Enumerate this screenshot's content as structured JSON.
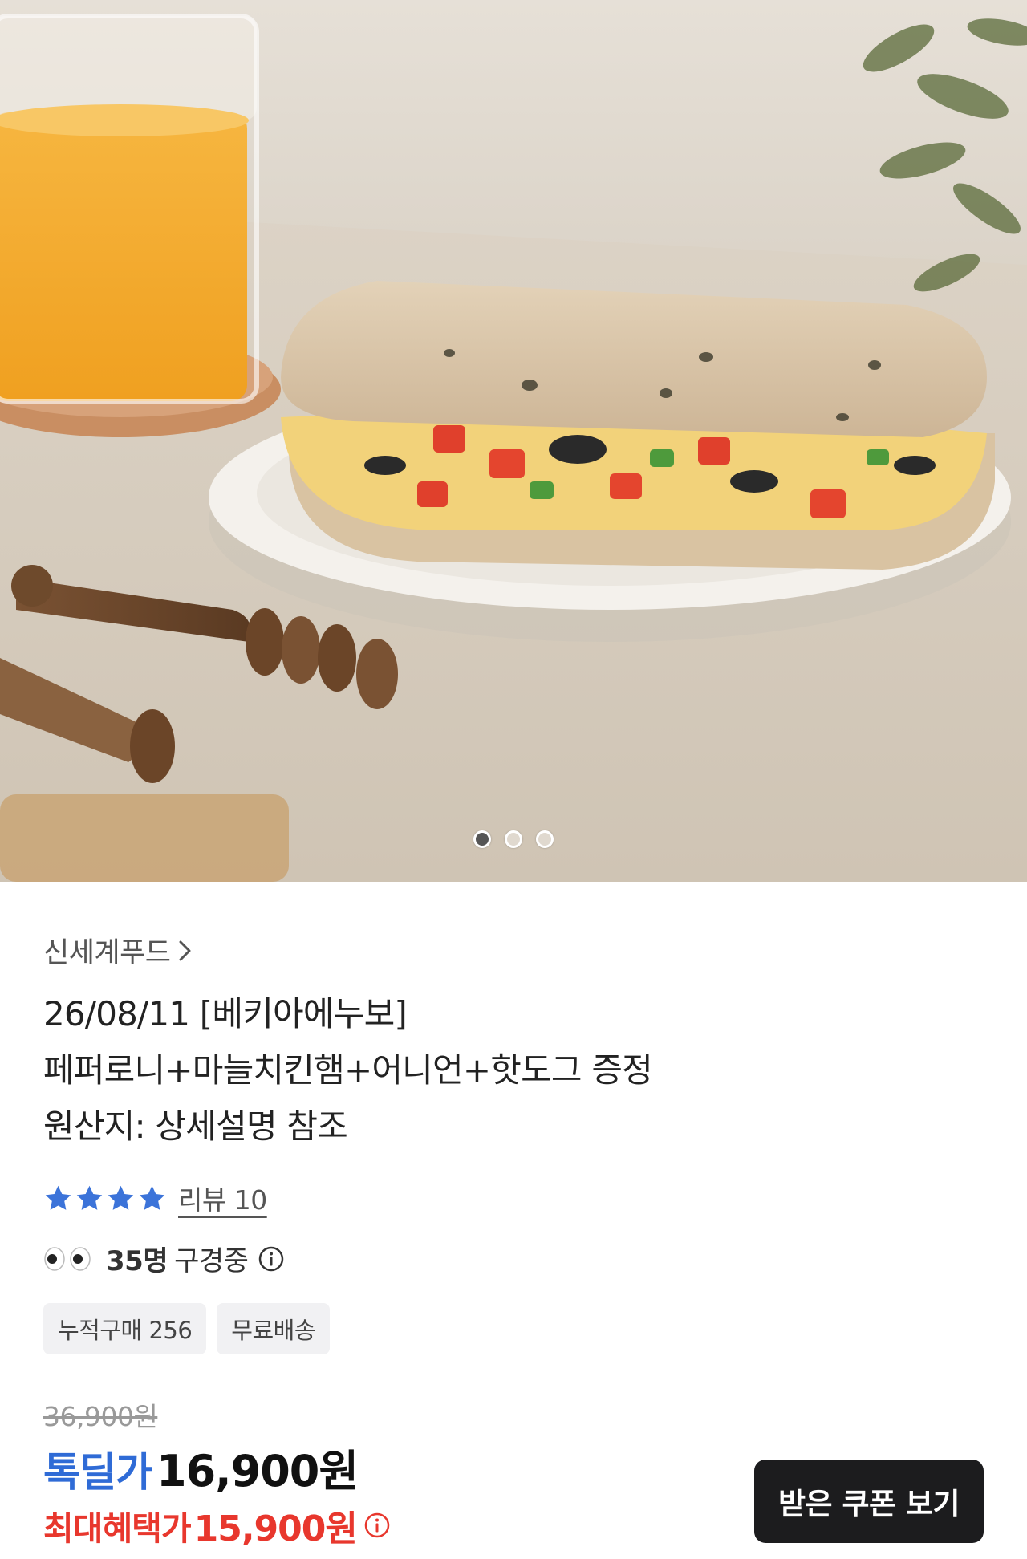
{
  "carousel": {
    "image_description_icon": "product-photo",
    "slide_count": 3,
    "active_slide": 1
  },
  "product": {
    "brand": "신세계푸드",
    "title_lines": [
      "26/08/11 [베키아에누보]",
      "페퍼로니+마늘치킨햄+어니언+핫도그 증정",
      "원산지: 상세설명 참조"
    ],
    "rating_stars": 4,
    "review_label": "리뷰 10",
    "viewers_count": "35명",
    "viewers_label": "구경중",
    "badges": [
      "누적구매 256",
      "무료배송"
    ],
    "original_price": "36,900원",
    "deal_label": "톡딜가",
    "deal_price": "16,900원",
    "max_benefit_label": "최대혜택가",
    "max_benefit_price": "15,900원",
    "coupon_button": "받은 쿠폰 보기"
  },
  "colors": {
    "deal_blue": "#2f6bd6",
    "benefit_red": "#e8372d",
    "star_blue": "#3b73d9",
    "button_dark": "#1c1c1e"
  }
}
